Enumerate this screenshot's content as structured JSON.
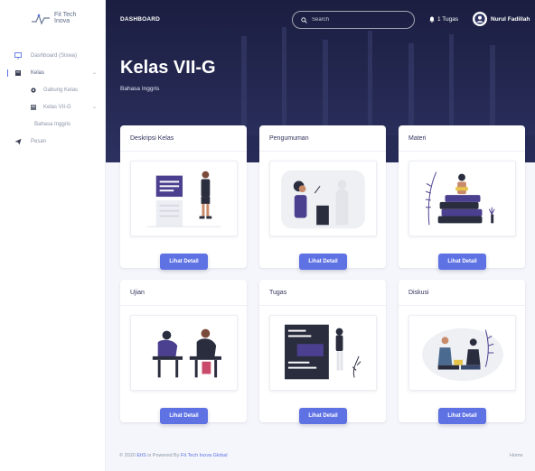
{
  "brand": {
    "line1": "Fit Tech",
    "line2": "Inova"
  },
  "sidebar": {
    "items": [
      {
        "label": "Dashboard (Siswa)",
        "icon": "monitor-icon"
      },
      {
        "label": "Kelas",
        "icon": "class-icon",
        "active": true
      },
      {
        "label": "Gabung Kelas",
        "icon": "gear-icon"
      },
      {
        "label": "Kelas VII-G",
        "icon": "class-icon"
      },
      {
        "label": "Bahasa Inggris"
      },
      {
        "label": "Pesan",
        "icon": "send-icon"
      }
    ]
  },
  "topbar": {
    "title": "DASHBOARD",
    "search_placeholder": "Search",
    "tugas": "1 Tugas",
    "user_name": "Nurul Fadillah"
  },
  "header": {
    "class_title": "Kelas VII-G",
    "subject": "Bahasa Inggris"
  },
  "cards": [
    {
      "title": "Deskripsi Kelas",
      "button": "Lihat Detail"
    },
    {
      "title": "Pengumuman",
      "button": "Lihat Detail"
    },
    {
      "title": "Materi",
      "button": "Lihat Detail"
    },
    {
      "title": "Ujian",
      "button": "Lihat Detail"
    },
    {
      "title": "Tugas",
      "button": "Lihat Detail"
    },
    {
      "title": "Diskusi",
      "button": "Lihat Detail"
    }
  ],
  "footer": {
    "prefix": "© 2020",
    "app": "EtIS",
    "middle": "is Powered By",
    "company": "Fit Tech Inova Global",
    "right": "Home"
  },
  "colors": {
    "primary": "#5e72e4",
    "header_bg": "#1f2349",
    "illustration_purple": "#4b3f8f"
  }
}
